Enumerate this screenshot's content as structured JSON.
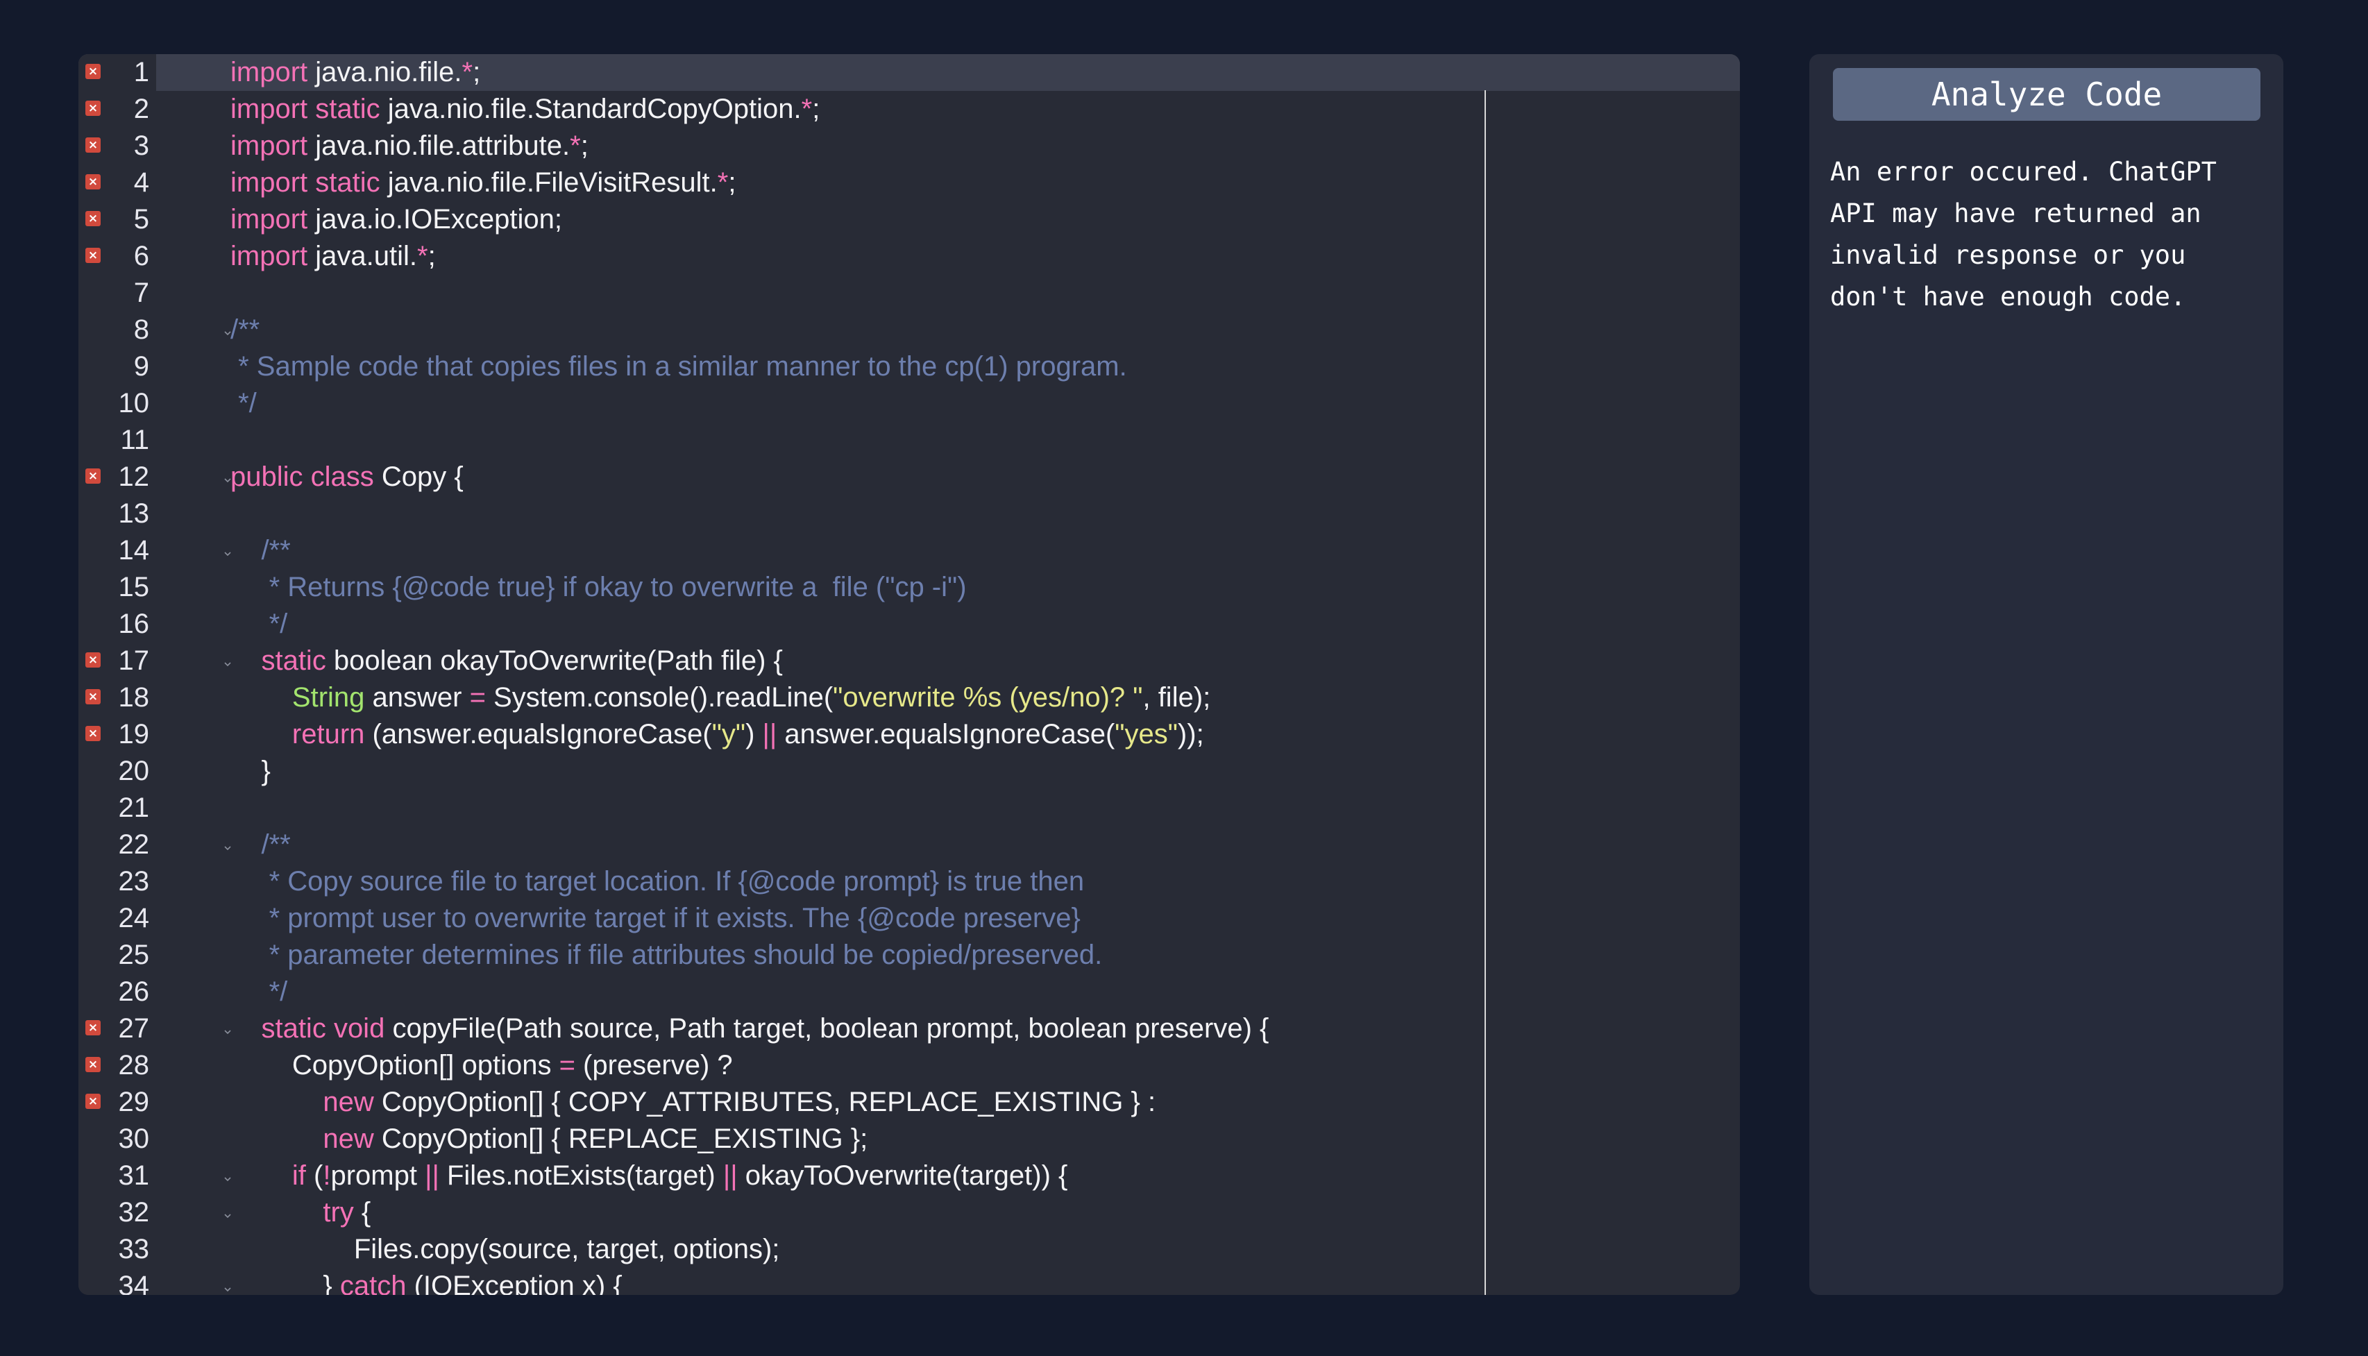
{
  "editor": {
    "lines": [
      {
        "n": "1",
        "err": true,
        "fold": false,
        "tokens": [
          [
            "kw",
            "import"
          ],
          [
            "pl",
            " java.nio.file."
          ],
          [
            "op",
            "*"
          ],
          [
            "pl",
            ";"
          ]
        ]
      },
      {
        "n": "2",
        "err": true,
        "fold": false,
        "tokens": [
          [
            "kw",
            "import"
          ],
          [
            "pl",
            " "
          ],
          [
            "kw",
            "static"
          ],
          [
            "pl",
            " java.nio.file.StandardCopyOption."
          ],
          [
            "op",
            "*"
          ],
          [
            "pl",
            ";"
          ]
        ]
      },
      {
        "n": "3",
        "err": true,
        "fold": false,
        "tokens": [
          [
            "kw",
            "import"
          ],
          [
            "pl",
            " java.nio.file.attribute."
          ],
          [
            "op",
            "*"
          ],
          [
            "pl",
            ";"
          ]
        ]
      },
      {
        "n": "4",
        "err": true,
        "fold": false,
        "tokens": [
          [
            "kw",
            "import"
          ],
          [
            "pl",
            " "
          ],
          [
            "kw",
            "static"
          ],
          [
            "pl",
            " java.nio.file.FileVisitResult."
          ],
          [
            "op",
            "*"
          ],
          [
            "pl",
            ";"
          ]
        ]
      },
      {
        "n": "5",
        "err": true,
        "fold": false,
        "tokens": [
          [
            "kw",
            "import"
          ],
          [
            "pl",
            " java.io.IOException;"
          ]
        ]
      },
      {
        "n": "6",
        "err": true,
        "fold": false,
        "tokens": [
          [
            "kw",
            "import"
          ],
          [
            "pl",
            " java.util."
          ],
          [
            "op",
            "*"
          ],
          [
            "pl",
            ";"
          ]
        ]
      },
      {
        "n": "7",
        "err": false,
        "fold": false,
        "tokens": []
      },
      {
        "n": "8",
        "err": false,
        "fold": true,
        "tokens": [
          [
            "cm",
            "/**"
          ]
        ]
      },
      {
        "n": "9",
        "err": false,
        "fold": false,
        "tokens": [
          [
            "cm",
            " * Sample code that copies files in a similar manner to the cp(1) program."
          ]
        ]
      },
      {
        "n": "10",
        "err": false,
        "fold": false,
        "tokens": [
          [
            "cm",
            " */"
          ]
        ]
      },
      {
        "n": "11",
        "err": false,
        "fold": false,
        "tokens": []
      },
      {
        "n": "12",
        "err": true,
        "fold": true,
        "tokens": [
          [
            "kw",
            "public"
          ],
          [
            "pl",
            " "
          ],
          [
            "kw",
            "class"
          ],
          [
            "pl",
            " Copy {"
          ]
        ]
      },
      {
        "n": "13",
        "err": false,
        "fold": false,
        "tokens": []
      },
      {
        "n": "14",
        "err": false,
        "fold": true,
        "tokens": [
          [
            "cm",
            "    /**"
          ]
        ]
      },
      {
        "n": "15",
        "err": false,
        "fold": false,
        "tokens": [
          [
            "cm",
            "     * Returns {@code true} if okay to overwrite a  file (\"cp -i\")"
          ]
        ]
      },
      {
        "n": "16",
        "err": false,
        "fold": false,
        "tokens": [
          [
            "cm",
            "     */"
          ]
        ]
      },
      {
        "n": "17",
        "err": true,
        "fold": true,
        "tokens": [
          [
            "pl",
            "    "
          ],
          [
            "kw",
            "static"
          ],
          [
            "pl",
            " boolean okayToOverwrite(Path file) {"
          ]
        ]
      },
      {
        "n": "18",
        "err": true,
        "fold": false,
        "tokens": [
          [
            "pl",
            "        "
          ],
          [
            "ty",
            "String"
          ],
          [
            "pl",
            " answer "
          ],
          [
            "op",
            "="
          ],
          [
            "pl",
            " System.console().readLine("
          ],
          [
            "str",
            "\"overwrite %s (yes/no)? \""
          ],
          [
            "pl",
            ", file);"
          ]
        ]
      },
      {
        "n": "19",
        "err": true,
        "fold": false,
        "tokens": [
          [
            "pl",
            "        "
          ],
          [
            "kw",
            "return"
          ],
          [
            "pl",
            " (answer.equalsIgnoreCase("
          ],
          [
            "str",
            "\"y\""
          ],
          [
            "pl",
            ") "
          ],
          [
            "op",
            "||"
          ],
          [
            "pl",
            " answer.equalsIgnoreCase("
          ],
          [
            "str",
            "\"yes\""
          ],
          [
            "pl",
            "));"
          ]
        ]
      },
      {
        "n": "20",
        "err": false,
        "fold": false,
        "tokens": [
          [
            "pl",
            "    }"
          ]
        ]
      },
      {
        "n": "21",
        "err": false,
        "fold": false,
        "tokens": []
      },
      {
        "n": "22",
        "err": false,
        "fold": true,
        "tokens": [
          [
            "cm",
            "    /**"
          ]
        ]
      },
      {
        "n": "23",
        "err": false,
        "fold": false,
        "tokens": [
          [
            "cm",
            "     * Copy source file to target location. If {@code prompt} is true then"
          ]
        ]
      },
      {
        "n": "24",
        "err": false,
        "fold": false,
        "tokens": [
          [
            "cm",
            "     * prompt user to overwrite target if it exists. The {@code preserve}"
          ]
        ]
      },
      {
        "n": "25",
        "err": false,
        "fold": false,
        "tokens": [
          [
            "cm",
            "     * parameter determines if file attributes should be copied/preserved."
          ]
        ]
      },
      {
        "n": "26",
        "err": false,
        "fold": false,
        "tokens": [
          [
            "cm",
            "     */"
          ]
        ]
      },
      {
        "n": "27",
        "err": true,
        "fold": true,
        "tokens": [
          [
            "pl",
            "    "
          ],
          [
            "kw",
            "static"
          ],
          [
            "pl",
            " "
          ],
          [
            "kw",
            "void"
          ],
          [
            "pl",
            " copyFile(Path source, Path target, boolean prompt, boolean preserve) {"
          ]
        ]
      },
      {
        "n": "28",
        "err": true,
        "fold": false,
        "tokens": [
          [
            "pl",
            "        CopyOption[] options "
          ],
          [
            "op",
            "="
          ],
          [
            "pl",
            " (preserve) ?"
          ]
        ]
      },
      {
        "n": "29",
        "err": true,
        "fold": false,
        "tokens": [
          [
            "pl",
            "            "
          ],
          [
            "kw",
            "new"
          ],
          [
            "pl",
            " CopyOption[] { COPY_ATTRIBUTES, REPLACE_EXISTING } :"
          ]
        ]
      },
      {
        "n": "30",
        "err": false,
        "fold": false,
        "tokens": [
          [
            "pl",
            "            "
          ],
          [
            "kw",
            "new"
          ],
          [
            "pl",
            " CopyOption[] { REPLACE_EXISTING };"
          ]
        ]
      },
      {
        "n": "31",
        "err": false,
        "fold": true,
        "tokens": [
          [
            "pl",
            "        "
          ],
          [
            "kw",
            "if"
          ],
          [
            "pl",
            " ("
          ],
          [
            "op",
            "!"
          ],
          [
            "pl",
            "prompt "
          ],
          [
            "op",
            "||"
          ],
          [
            "pl",
            " Files.notExists(target) "
          ],
          [
            "op",
            "||"
          ],
          [
            "pl",
            " okayToOverwrite(target)) {"
          ]
        ]
      },
      {
        "n": "32",
        "err": false,
        "fold": true,
        "tokens": [
          [
            "pl",
            "            "
          ],
          [
            "kw",
            "try"
          ],
          [
            "pl",
            " {"
          ]
        ]
      },
      {
        "n": "33",
        "err": false,
        "fold": false,
        "tokens": [
          [
            "pl",
            "                Files.copy(source, target, options);"
          ]
        ]
      },
      {
        "n": "34",
        "err": false,
        "fold": true,
        "tokens": [
          [
            "pl",
            "            } "
          ],
          [
            "kw",
            "catch"
          ],
          [
            "pl",
            " (IOException x) {"
          ]
        ]
      }
    ]
  },
  "panel": {
    "analyze_button_label": "Analyze Code",
    "error_message": "An error occured. ChatGPT API may have returned an invalid response or you don't have enough code."
  },
  "colors": {
    "page_bg": "#131a2c",
    "editor_bg": "#282b36",
    "keyword": "#f472b6",
    "string": "#e6e88a",
    "comment": "#6d7fae",
    "type": "#a3e46e",
    "error_marker": "#d14a3d",
    "button_bg": "#5b6883"
  }
}
